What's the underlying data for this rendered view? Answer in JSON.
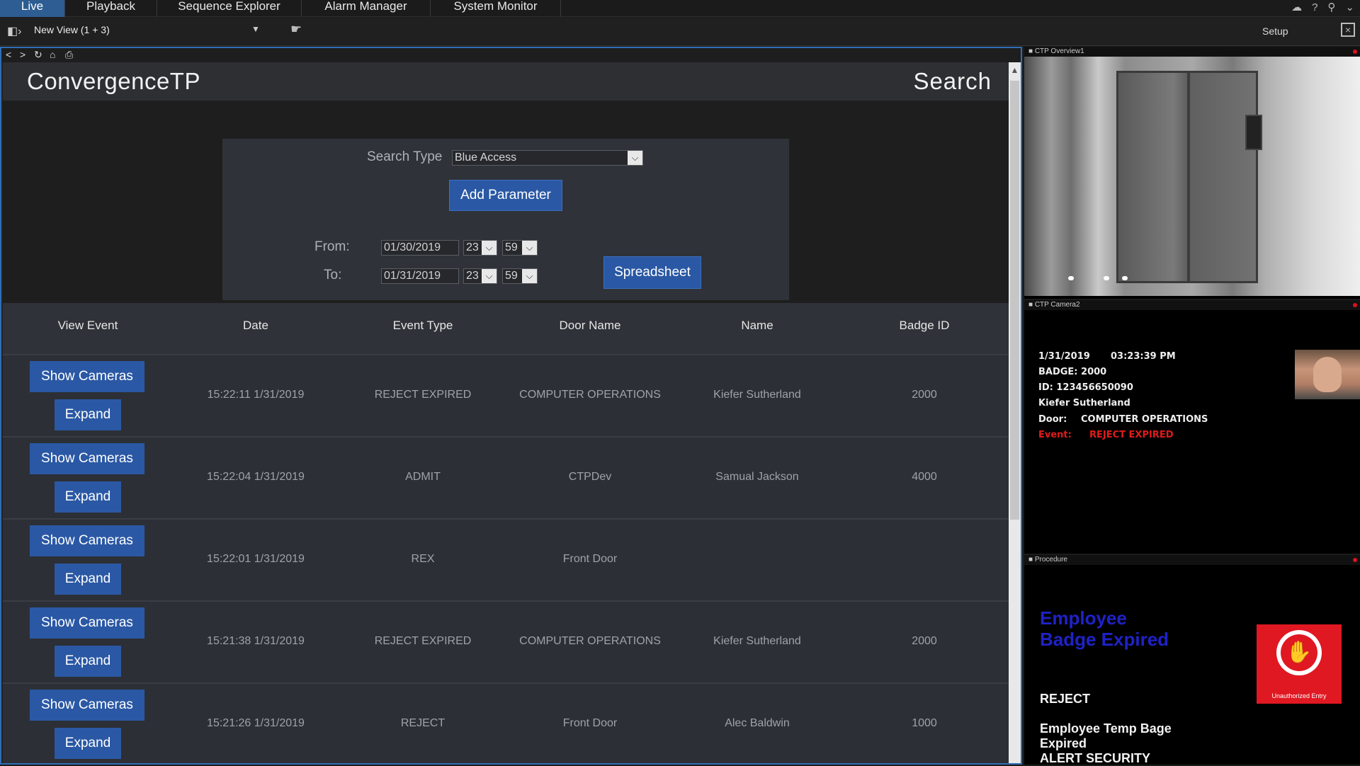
{
  "tabs": [
    "Live",
    "Playback",
    "Sequence Explorer",
    "Alarm Manager",
    "System Monitor"
  ],
  "toolbar": {
    "view_name": "New View (1 + 3)",
    "setup_label": "Setup"
  },
  "app": {
    "brand": "ConvergenceTP",
    "page_title": "Search"
  },
  "search": {
    "type_label": "Search Type",
    "type_value": "Blue Access",
    "add_param_label": "Add Parameter",
    "from_label": "From:",
    "from_date": "01/30/2019",
    "from_hour": "23",
    "from_minute": "59",
    "to_label": "To:",
    "to_date": "01/31/2019",
    "to_hour": "23",
    "to_minute": "59",
    "spreadsheet_label": "Spreadsheet"
  },
  "table": {
    "columns": [
      "View Event",
      "Date",
      "Event Type",
      "Door Name",
      "Name",
      "Badge ID"
    ],
    "show_cameras_label": "Show Cameras",
    "expand_label": "Expand",
    "rows": [
      {
        "date": "15:22:11 1/31/2019",
        "event_type": "REJECT EXPIRED",
        "door": "COMPUTER OPERATIONS",
        "name": "Kiefer Sutherland",
        "badge": "2000"
      },
      {
        "date": "15:22:04 1/31/2019",
        "event_type": "ADMIT",
        "door": "CTPDev",
        "name": "Samual Jackson",
        "badge": "4000"
      },
      {
        "date": "15:22:01 1/31/2019",
        "event_type": "REX",
        "door": "Front Door",
        "name": "",
        "badge": ""
      },
      {
        "date": "15:21:38 1/31/2019",
        "event_type": "REJECT EXPIRED",
        "door": "COMPUTER OPERATIONS",
        "name": "Kiefer Sutherland",
        "badge": "2000"
      },
      {
        "date": "15:21:26 1/31/2019",
        "event_type": "REJECT",
        "door": "Front Door",
        "name": "Alec Baldwin",
        "badge": "1000"
      }
    ]
  },
  "cameras": {
    "cam1_title": "CTP Overview1",
    "cam2_title": "CTP Camera2",
    "proc_title": "Procedure",
    "overlay": {
      "date": "1/31/2019",
      "time": "03:23:39 PM",
      "badge": "BADGE: 2000",
      "id": "ID: 123456650090",
      "name": "Kiefer Sutherland",
      "door_label": "Door:",
      "door_value": "COMPUTER OPERATIONS",
      "event_label": "Event:",
      "event_value": "REJECT EXPIRED"
    },
    "procedure": {
      "heading": "Employee Badge Expired",
      "reject": "REJECT",
      "line1": "Employee Temp Bage",
      "line2": "Expired",
      "line3": "ALERT SECURITY",
      "sign_caption": "Unauthorized Entry"
    }
  },
  "colors": {
    "accent": "#2a58a4",
    "alert_red": "#e11b1b",
    "proc_blue": "#1f22c7"
  }
}
